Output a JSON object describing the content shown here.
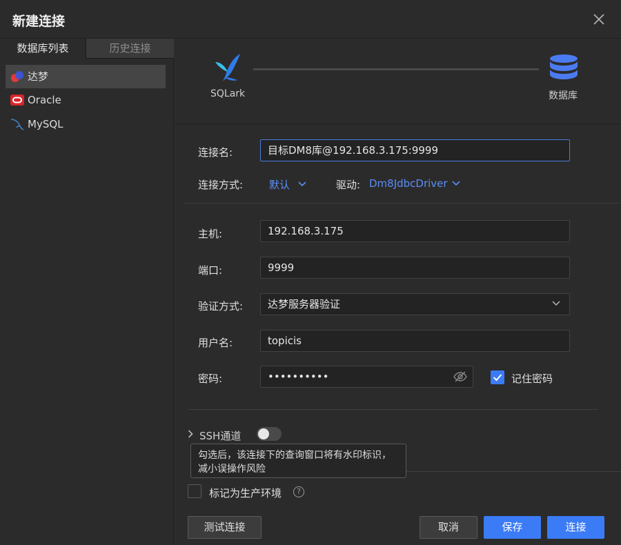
{
  "window": {
    "title": "新建连接"
  },
  "sidebar": {
    "tabs": [
      {
        "label": "数据库列表"
      },
      {
        "label": "历史连接"
      }
    ],
    "items": [
      {
        "label": "达梦",
        "icon": "dameng-logo-icon"
      },
      {
        "label": "Oracle",
        "icon": "oracle-logo-icon"
      },
      {
        "label": "MySQL",
        "icon": "mysql-dolphin-icon"
      }
    ]
  },
  "banner": {
    "source_label": "SQLark",
    "target_label": "数据库"
  },
  "form": {
    "connection_name": {
      "label": "连接名:",
      "value": "目标DM8库@192.168.3.175:9999"
    },
    "connection_mode": {
      "label": "连接方式:",
      "value": "默认"
    },
    "driver": {
      "label": "驱动:",
      "value": "Dm8JdbcDriver"
    },
    "host": {
      "label": "主机:",
      "value": "192.168.3.175"
    },
    "port": {
      "label": "端口:",
      "value": "9999"
    },
    "auth": {
      "label": "验证方式:",
      "value": "达梦服务器验证"
    },
    "username": {
      "label": "用户名:",
      "value": "topicis"
    },
    "password": {
      "label": "密码:",
      "value": "••••••••••"
    },
    "remember_password": {
      "label": "记住密码",
      "checked": true
    },
    "ssh": {
      "label": "SSH通道",
      "enabled": false
    },
    "tooltip": "勾选后，该连接下的查询窗口将有水印标识，减小误操作风险",
    "production": {
      "label": "标记为生产环境",
      "checked": false,
      "help": "?"
    }
  },
  "buttons": {
    "test": "测试连接",
    "cancel": "取消",
    "save": "保存",
    "connect": "连接"
  },
  "colors": {
    "accent": "#3b7bf5",
    "link": "#5b8ff9",
    "background": "#2b2b2b"
  }
}
